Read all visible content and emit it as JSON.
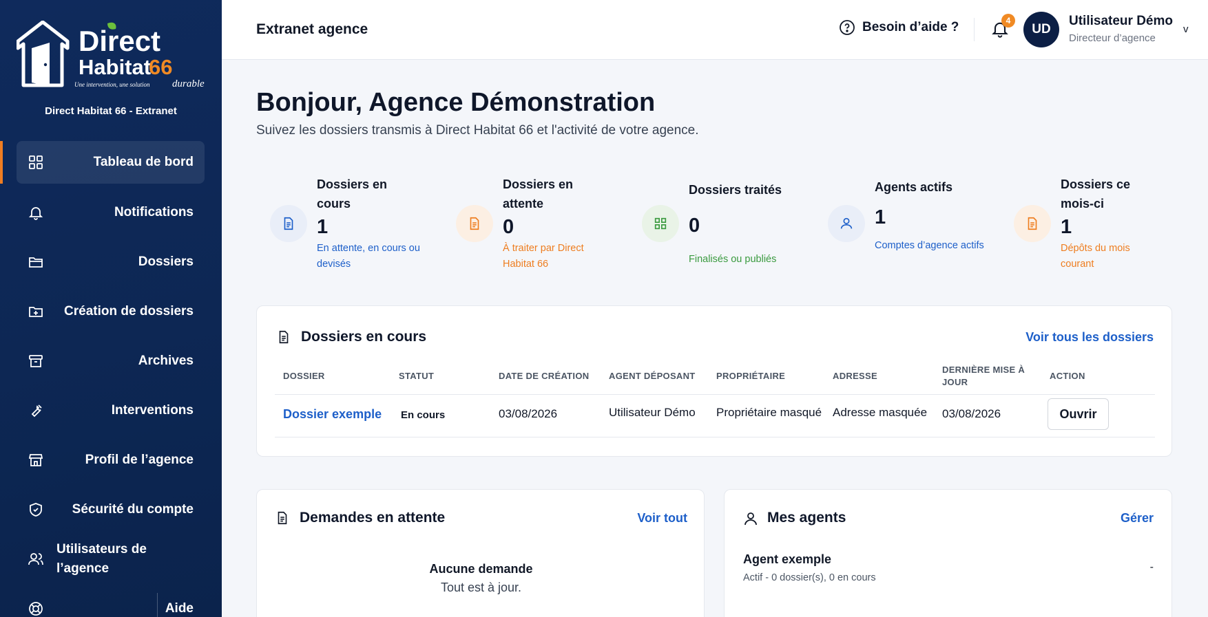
{
  "sidebar": {
    "logo": {
      "line1": "Direct",
      "line2": "Habitat",
      "number": "66",
      "tagline": "Une intervention, une solution",
      "tagline_accent": "durable"
    },
    "subtitle": "Direct Habitat 66 - Extranet",
    "items": [
      {
        "label": "Tableau de bord",
        "icon": "dashboard-icon",
        "active": true
      },
      {
        "label": "Notifications",
        "icon": "bell-icon"
      },
      {
        "label": "Dossiers",
        "icon": "folder-icon"
      },
      {
        "label": "Création de dossiers",
        "icon": "folder-plus-icon"
      },
      {
        "label": "Archives",
        "icon": "archive-icon"
      },
      {
        "label": "Interventions",
        "icon": "wrench-icon"
      },
      {
        "label": "Profil de l’agence",
        "icon": "store-icon"
      },
      {
        "label": "Sécurité du compte",
        "icon": "shield-icon"
      },
      {
        "label": "Utilisateurs de l’agence",
        "icon": "users-icon"
      },
      {
        "label": "Aide",
        "icon": "lifebuoy-icon"
      }
    ]
  },
  "header": {
    "title": "Extranet agence",
    "help_label": "Besoin d’aide ?",
    "notif_count": "4",
    "user": {
      "initials": "UD",
      "name": "Utilisateur Démo",
      "role": "Directeur d’agence",
      "chevron": "v"
    }
  },
  "main": {
    "title": "Bonjour, Agence Démonstration",
    "subtitle": "Suivez les dossiers transmis à Direct Habitat 66 et l'activité de votre agence.",
    "stats": [
      {
        "label": "Dossiers en cours",
        "value": "1",
        "desc": "En attente, en cours ou devisés",
        "color": "#1d5fc9",
        "icon": "document-icon"
      },
      {
        "label": "Dossiers en attente",
        "value": "0",
        "desc": "À traiter par Direct Habitat 66",
        "color": "#ee7d1f",
        "icon": "document-icon"
      },
      {
        "label": "Dossiers traités",
        "value": "0",
        "desc": "Finalisés ou publiés",
        "color": "#3a9a3f",
        "icon": "grid-icon"
      },
      {
        "label": "Agents actifs",
        "value": "1",
        "desc": "Comptes d’agence actifs",
        "color": "#1d5fc9",
        "icon": "user-icon"
      },
      {
        "label": "Dossiers ce mois-ci",
        "value": "1",
        "desc": "Dépôts du mois courant",
        "color": "#ee7d1f",
        "icon": "document-icon"
      }
    ],
    "dossiers_card": {
      "title": "Dossiers en cours",
      "link": "Voir tous les dossiers",
      "columns": [
        "DOSSIER",
        "STATUT",
        "DATE DE CRÉATION",
        "AGENT DÉPOSANT",
        "PROPRIÉTAIRE",
        "ADRESSE",
        "DERNIÈRE MISE À JOUR",
        "ACTION"
      ],
      "rows": [
        {
          "dossier": "Dossier exemple",
          "statut": "En cours",
          "date": "03/08/2026",
          "agent": "Utilisateur Démo",
          "proprietaire": "Propriétaire masqué",
          "adresse": "Adresse masquée",
          "maj": "03/08/2026",
          "action": "Ouvrir"
        }
      ]
    },
    "demandes_card": {
      "title": "Demandes en attente",
      "link": "Voir tout",
      "empty_title": "Aucune demande",
      "empty_sub": "Tout est à jour."
    },
    "agents_card": {
      "title": "Mes agents",
      "link": "Gérer",
      "agents": [
        {
          "name": "Agent exemple",
          "meta": "Actif - 0 dossier(s), 0 en cours",
          "value": "-"
        }
      ]
    }
  },
  "colors": {
    "sidebar": "#0d2754",
    "accent_orange": "#ee7d1f",
    "accent_blue": "#1d5fc9",
    "accent_green": "#3a9a3f"
  }
}
